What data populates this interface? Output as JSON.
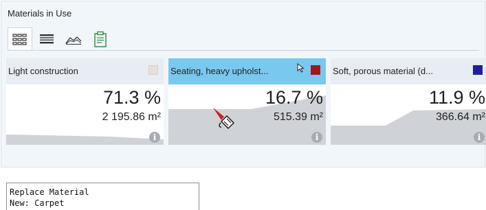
{
  "panel": {
    "title": "Materials in Use",
    "views": [
      {
        "name": "tiles-view-icon",
        "active": true
      },
      {
        "name": "list-view-icon",
        "active": false
      },
      {
        "name": "chart-view-icon",
        "active": false
      },
      {
        "name": "clipboard-report-icon",
        "active": false
      }
    ]
  },
  "cards": [
    {
      "name": "Light construction",
      "percent": "71.3 %",
      "area": "2 195.86 m²",
      "swatch_color": "#e6e0d6",
      "selected": false
    },
    {
      "name": "Seating, heavy upholst...",
      "percent": "16.7 %",
      "area": "515.39 m²",
      "swatch_color": "#a3171c",
      "selected": true
    },
    {
      "name": "Soft, porous material (d...",
      "percent": "11.9 %",
      "area": "366.64 m²",
      "swatch_color": "#1f1f9a",
      "selected": false
    }
  ],
  "status": {
    "line1": "Replace Material",
    "line2": "New: Carpet"
  },
  "colors": {
    "selected_header": "#78c8f0",
    "card_header": "#e8edf3",
    "sparkline_fill": "#cfd3d8"
  }
}
